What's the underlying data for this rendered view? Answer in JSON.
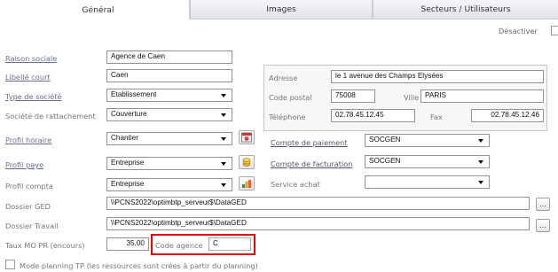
{
  "tabs": [
    {
      "label": "Général",
      "active": true
    },
    {
      "label": "Images",
      "active": false
    },
    {
      "label": "Secteurs / Utilisateurs",
      "active": false
    }
  ],
  "desactiver_label": "Désactiver",
  "fields": {
    "raison_sociale": {
      "label": "Raison sociale",
      "value": "Agence de Caen"
    },
    "libelle_court": {
      "label": "Libellé court",
      "value": "Caen"
    },
    "type_societe": {
      "label": "Type de société",
      "value": "Etablissement"
    },
    "societe_rattachement": {
      "label": "Société de rattachement",
      "value": "Couverture"
    },
    "profil_horaire": {
      "label": "Profil horaire",
      "value": "Chantier"
    },
    "profil_paye": {
      "label": "Profil paye",
      "value": "Entreprise"
    },
    "profil_compta": {
      "label": "Profil compta",
      "value": "Entreprise"
    },
    "dossier_ged": {
      "label": "Dossier GED",
      "value": "\\\\PCNS2022\\optimbtp_serveur$\\DataGED"
    },
    "dossier_travail": {
      "label": "Dossier Travail",
      "value": "\\\\PCNS2022\\optimbtp_serveur$\\DataGED"
    },
    "taux_mo": {
      "label": "Taux MO PR (encours)",
      "value": "35,00"
    },
    "code_agence": {
      "label": "Code agence",
      "value": "C"
    }
  },
  "address": {
    "adresse_label": "Adresse",
    "adresse_value": "le 1 avenue des Champs Elysées",
    "code_postal_label": "Code postal",
    "code_postal_value": "75008",
    "ville_label": "Ville",
    "ville_value": "PARIS",
    "telephone_label": "Téléphone",
    "telephone_value": "02.78.45.12.45",
    "fax_label": "Fax",
    "fax_value": "02.78.45.12.46"
  },
  "payment": {
    "compte_paiement_label": "Compte de paiement",
    "compte_paiement_value": "SOCGEN",
    "compte_facturation_label": "Compte de facturation",
    "compte_facturation_value": "SOCGEN",
    "service_achat_label": "Service achat",
    "service_achat_value": ""
  },
  "buttons": {
    "browse": "..."
  },
  "mode_planning_label": "Mode planning TP (les ressources sont crées à partir du planning)",
  "colors": {
    "highlight": "#e00000",
    "link": "#6a6f99"
  }
}
